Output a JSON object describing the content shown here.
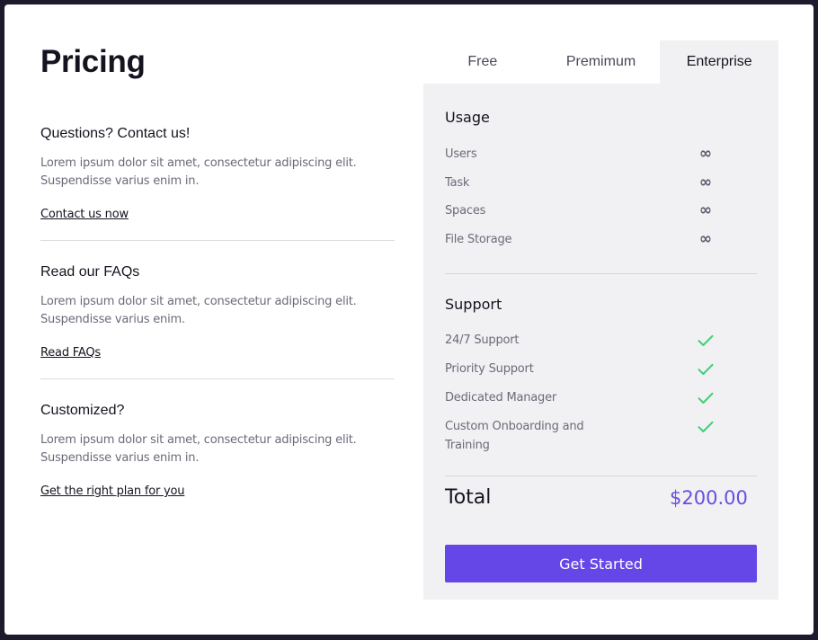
{
  "title": "Pricing",
  "sections": [
    {
      "heading": "Questions? Contact us!",
      "body": "Lorem ipsum dolor sit amet, consectetur adipiscing elit. Suspendisse varius enim in.",
      "link": "Contact us now"
    },
    {
      "heading": "Read our FAQs",
      "body": "Lorem ipsum dolor sit amet, consectetur adipiscing elit. Suspendisse varius enim.",
      "link": "Read FAQs"
    },
    {
      "heading": "Customized?",
      "body": "Lorem ipsum dolor sit amet, consectetur adipiscing elit. Suspendisse varius enim in.",
      "link": "Get the right plan for you"
    }
  ],
  "tabs": [
    {
      "label": "Free",
      "active": false
    },
    {
      "label": "Premimum",
      "active": false
    },
    {
      "label": "Enterprise",
      "active": true
    }
  ],
  "usage": {
    "title": "Usage",
    "rows": [
      {
        "label": "Users",
        "value": "∞"
      },
      {
        "label": "Task",
        "value": "∞"
      },
      {
        "label": "Spaces",
        "value": "∞"
      },
      {
        "label": "File Storage",
        "value": "∞"
      }
    ]
  },
  "support": {
    "title": "Support",
    "rows": [
      {
        "label": "24/7 Support",
        "icon": "check-icon"
      },
      {
        "label": "Priority Support",
        "icon": "check-icon"
      },
      {
        "label": "Dedicated Manager",
        "icon": "check-icon"
      },
      {
        "label": "Custom Onboarding and Training",
        "icon": "check-icon"
      }
    ]
  },
  "total": {
    "label": "Total",
    "value": "$200.00"
  },
  "cta_label": "Get Started",
  "colors": {
    "accent": "#6546e6",
    "price": "#6b4ee0",
    "check": "#3ecf74",
    "panel_bg": "#f1f1f3"
  }
}
